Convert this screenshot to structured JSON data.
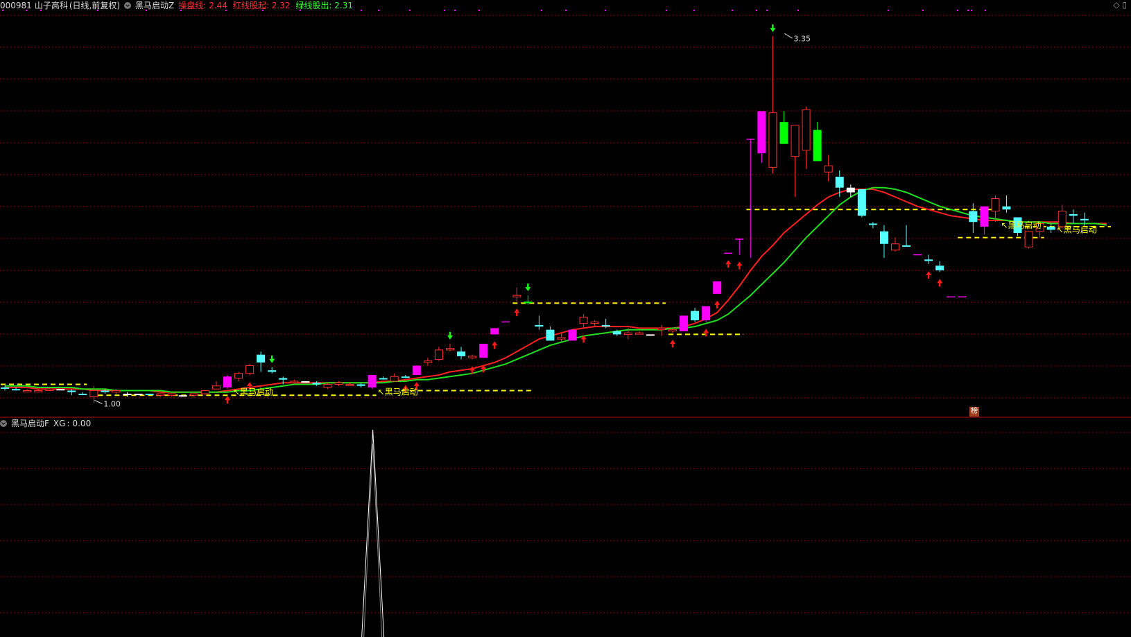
{
  "main_header": {
    "code": "000981",
    "name": "山子高科",
    "period": "(日线,前复权)",
    "indicator_name": "黑马启动Z",
    "items": [
      {
        "label": "操盘线",
        "value": "2.44",
        "color": "#ff3030"
      },
      {
        "label": "红线股起",
        "value": "2.32",
        "color": "#ff3030"
      },
      {
        "label": "绿线股出",
        "value": "2.31",
        "color": "#30ff30"
      }
    ]
  },
  "sub_header": {
    "indicator_name": "黑马启动F",
    "items": [
      {
        "label": "XG",
        "value": "0.00"
      }
    ]
  },
  "corner_icon": "diamond-icon",
  "badge_text": "榜",
  "colors": {
    "grid": "#8b0000",
    "up": "#ff3030",
    "down_cyan": "#54ffff",
    "magenta": "#ff00ff",
    "green_bar": "#00ff00",
    "red_line": "#ff2020",
    "green_line": "#20e020",
    "yellow_dash": "#ffff00",
    "label_text": "#ffff00"
  },
  "chart_data": [
    {
      "type": "candlestick",
      "ylim": [
        0.95,
        3.5
      ],
      "y_is_log": false,
      "annotations": [
        {
          "text": "3.35",
          "kind": "high",
          "bar": 70,
          "price": 3.35
        },
        {
          "text": "1.00",
          "kind": "low",
          "bar": 8,
          "price": 1.0
        },
        {
          "text": "黑马启动",
          "kind": "signal",
          "bar": 20,
          "price": 1.07
        },
        {
          "text": "黑马启动",
          "kind": "signal",
          "bar": 33,
          "price": 1.07
        },
        {
          "text": "黑马启动",
          "kind": "signal",
          "bar": 89,
          "price": 2.14
        },
        {
          "text": "黑马启动",
          "kind": "signal",
          "bar": 94,
          "price": 2.11
        }
      ],
      "candles": [
        [
          1.1,
          1.11,
          1.08,
          1.1,
          "c"
        ],
        [
          1.09,
          1.1,
          1.08,
          1.09,
          "c"
        ],
        [
          1.08,
          1.09,
          1.08,
          1.08,
          "r"
        ],
        [
          1.08,
          1.09,
          1.07,
          1.08,
          "r"
        ],
        [
          1.08,
          1.1,
          1.08,
          1.09,
          "r"
        ],
        [
          1.09,
          1.09,
          1.09,
          1.09,
          "w"
        ],
        [
          1.08,
          1.09,
          1.05,
          1.07,
          "c"
        ],
        [
          1.06,
          1.07,
          1.05,
          1.06,
          "c"
        ],
        [
          1.04,
          1.11,
          1.0,
          1.08,
          "r"
        ],
        [
          1.08,
          1.09,
          1.06,
          1.07,
          "c"
        ],
        [
          1.07,
          1.09,
          1.06,
          1.08,
          "r"
        ],
        [
          1.06,
          1.07,
          1.04,
          1.06,
          "w"
        ],
        [
          1.06,
          1.06,
          1.05,
          1.06,
          "w"
        ],
        [
          1.06,
          1.06,
          1.05,
          1.06,
          "c"
        ],
        [
          1.05,
          1.06,
          1.04,
          1.06,
          "r"
        ],
        [
          1.05,
          1.06,
          1.04,
          1.06,
          "r"
        ],
        [
          1.05,
          1.05,
          1.04,
          1.05,
          "w"
        ],
        [
          1.05,
          1.06,
          1.04,
          1.06,
          "r"
        ],
        [
          1.06,
          1.08,
          1.05,
          1.08,
          "r"
        ],
        [
          1.09,
          1.14,
          1.09,
          1.11,
          "r"
        ],
        [
          1.1,
          1.18,
          1.09,
          1.17,
          "m"
        ],
        [
          1.16,
          1.2,
          1.14,
          1.19,
          "r"
        ],
        [
          1.19,
          1.25,
          1.18,
          1.24,
          "r"
        ],
        [
          1.31,
          1.33,
          1.2,
          1.26,
          "c"
        ],
        [
          1.2,
          1.23,
          1.19,
          1.21,
          "c"
        ],
        [
          1.15,
          1.17,
          1.12,
          1.16,
          "c"
        ],
        [
          1.14,
          1.15,
          1.13,
          1.14,
          "r"
        ],
        [
          1.14,
          1.14,
          1.13,
          1.14,
          "w"
        ],
        [
          1.13,
          1.14,
          1.11,
          1.12,
          "c"
        ],
        [
          1.1,
          1.13,
          1.09,
          1.12,
          "r"
        ],
        [
          1.12,
          1.14,
          1.11,
          1.13,
          "r"
        ],
        [
          1.12,
          1.13,
          1.11,
          1.12,
          "r"
        ],
        [
          1.12,
          1.13,
          1.1,
          1.11,
          "c"
        ],
        [
          1.1,
          1.18,
          1.09,
          1.18,
          "m"
        ],
        [
          1.16,
          1.17,
          1.15,
          1.16,
          "c"
        ],
        [
          1.14,
          1.19,
          1.14,
          1.17,
          "r"
        ],
        [
          1.17,
          1.18,
          1.16,
          1.17,
          "c"
        ],
        [
          1.18,
          1.24,
          1.18,
          1.24,
          "m"
        ],
        [
          1.26,
          1.29,
          1.24,
          1.27,
          "r"
        ],
        [
          1.28,
          1.36,
          1.27,
          1.34,
          "r"
        ],
        [
          1.34,
          1.38,
          1.33,
          1.35,
          "r"
        ],
        [
          1.33,
          1.36,
          1.28,
          1.3,
          "c"
        ],
        [
          1.29,
          1.31,
          1.28,
          1.3,
          "r"
        ],
        [
          1.29,
          1.38,
          1.29,
          1.38,
          "m"
        ],
        [
          1.44,
          1.48,
          1.44,
          1.48,
          "m"
        ],
        [
          1.52,
          1.52,
          1.52,
          1.52,
          "p"
        ],
        [
          1.69,
          1.74,
          1.65,
          1.68,
          "r"
        ],
        [
          1.65,
          1.69,
          1.63,
          1.64,
          "g"
        ],
        [
          1.5,
          1.56,
          1.47,
          1.49,
          "c"
        ],
        [
          1.47,
          1.49,
          1.4,
          1.4,
          "c"
        ],
        [
          1.41,
          1.45,
          1.39,
          1.42,
          "r"
        ],
        [
          1.4,
          1.47,
          1.4,
          1.47,
          "m"
        ],
        [
          1.51,
          1.57,
          1.48,
          1.55,
          "r"
        ],
        [
          1.51,
          1.53,
          1.49,
          1.52,
          "r"
        ],
        [
          1.5,
          1.54,
          1.48,
          1.49,
          "c"
        ],
        [
          1.46,
          1.47,
          1.43,
          1.44,
          "c"
        ],
        [
          1.44,
          1.48,
          1.41,
          1.45,
          "r"
        ],
        [
          1.45,
          1.46,
          1.44,
          1.45,
          "r"
        ],
        [
          1.44,
          1.44,
          1.43,
          1.44,
          "w"
        ],
        [
          1.47,
          1.5,
          1.43,
          1.48,
          "r"
        ],
        [
          1.47,
          1.48,
          1.45,
          1.47,
          "r"
        ],
        [
          1.46,
          1.56,
          1.46,
          1.56,
          "m"
        ],
        [
          1.53,
          1.61,
          1.52,
          1.59,
          "c"
        ],
        [
          1.53,
          1.62,
          1.52,
          1.62,
          "m"
        ],
        [
          1.7,
          1.78,
          1.7,
          1.78,
          "m"
        ],
        [
          1.96,
          1.96,
          1.96,
          1.96,
          "p"
        ],
        [
          2.05,
          2.05,
          1.95,
          2.05,
          "p"
        ],
        [
          2.69,
          2.69,
          1.93,
          2.69,
          "p"
        ],
        [
          2.6,
          2.7,
          2.54,
          2.87,
          "m"
        ],
        [
          2.51,
          3.35,
          2.47,
          2.86,
          "r"
        ],
        [
          2.8,
          2.87,
          2.69,
          2.66,
          "g"
        ],
        [
          2.58,
          2.74,
          2.32,
          2.78,
          "r"
        ],
        [
          2.62,
          2.9,
          2.5,
          2.88,
          "r"
        ],
        [
          2.75,
          2.8,
          2.59,
          2.55,
          "g"
        ],
        [
          2.52,
          2.59,
          2.42,
          2.48,
          "r"
        ],
        [
          2.45,
          2.49,
          2.32,
          2.38,
          "c"
        ],
        [
          2.38,
          2.4,
          2.32,
          2.35,
          "w"
        ],
        [
          2.37,
          2.37,
          2.19,
          2.2,
          "c"
        ],
        [
          2.15,
          2.16,
          2.12,
          2.15,
          "c"
        ],
        [
          2.1,
          2.14,
          1.93,
          2.02,
          "c"
        ],
        [
          1.98,
          2.06,
          1.97,
          2.02,
          "r"
        ],
        [
          2.01,
          2.14,
          2.01,
          2.01,
          "c"
        ],
        [
          1.95,
          1.95,
          1.95,
          1.95,
          "p"
        ],
        [
          1.91,
          1.95,
          1.89,
          1.92,
          "c"
        ],
        [
          1.88,
          1.91,
          1.84,
          1.85,
          "c"
        ],
        [
          1.68,
          1.68,
          1.68,
          1.68,
          "p"
        ],
        [
          1.68,
          1.68,
          1.68,
          1.68,
          "p"
        ],
        [
          2.23,
          2.28,
          2.09,
          2.16,
          "c"
        ],
        [
          2.26,
          2.26,
          2.08,
          2.13,
          "m"
        ],
        [
          2.23,
          2.33,
          2.16,
          2.31,
          "r"
        ],
        [
          2.26,
          2.33,
          2.22,
          2.24,
          "c"
        ],
        [
          2.19,
          2.19,
          2.07,
          2.09,
          "c"
        ],
        [
          2.0,
          2.1,
          1.99,
          2.1,
          "r"
        ],
        [
          2.1,
          2.13,
          2.06,
          2.15,
          "r"
        ],
        [
          2.11,
          2.15,
          2.09,
          2.13,
          "c"
        ],
        [
          2.13,
          2.27,
          2.12,
          2.23,
          "r"
        ],
        [
          2.21,
          2.24,
          2.15,
          2.2,
          "c"
        ],
        [
          2.18,
          2.22,
          2.14,
          2.17,
          "c"
        ]
      ],
      "series": [
        {
          "name": "操盘线",
          "color": "#ff2020",
          "values": [
            1.1,
            1.1,
            1.1,
            1.09,
            1.09,
            1.09,
            1.09,
            1.09,
            1.08,
            1.08,
            1.08,
            1.08,
            1.08,
            1.08,
            1.07,
            1.07,
            1.07,
            1.07,
            1.07,
            1.07,
            1.08,
            1.09,
            1.1,
            1.11,
            1.12,
            1.13,
            1.13,
            1.13,
            1.13,
            1.13,
            1.13,
            1.13,
            1.13,
            1.13,
            1.14,
            1.14,
            1.15,
            1.16,
            1.17,
            1.18,
            1.2,
            1.21,
            1.22,
            1.24,
            1.26,
            1.29,
            1.33,
            1.37,
            1.41,
            1.43,
            1.45,
            1.47,
            1.48,
            1.49,
            1.49,
            1.49,
            1.49,
            1.48,
            1.48,
            1.48,
            1.48,
            1.49,
            1.51,
            1.54,
            1.58,
            1.66,
            1.75,
            1.85,
            1.94,
            2.01,
            2.09,
            2.15,
            2.21,
            2.27,
            2.32,
            2.35,
            2.37,
            2.37,
            2.37,
            2.35,
            2.32,
            2.29,
            2.26,
            2.24,
            2.22,
            2.2,
            2.19,
            2.18,
            2.17,
            2.17,
            2.17,
            2.16,
            2.16,
            2.16,
            2.16,
            2.16,
            2.15,
            2.15,
            2.15,
            2.15
          ]
        },
        {
          "name": "绿线",
          "color": "#20e020",
          "values": [
            1.11,
            1.11,
            1.11,
            1.1,
            1.1,
            1.1,
            1.1,
            1.09,
            1.09,
            1.09,
            1.08,
            1.08,
            1.08,
            1.08,
            1.08,
            1.07,
            1.07,
            1.07,
            1.07,
            1.07,
            1.07,
            1.08,
            1.08,
            1.09,
            1.1,
            1.11,
            1.12,
            1.12,
            1.12,
            1.13,
            1.13,
            1.13,
            1.13,
            1.13,
            1.13,
            1.14,
            1.14,
            1.15,
            1.15,
            1.16,
            1.17,
            1.18,
            1.19,
            1.21,
            1.23,
            1.25,
            1.28,
            1.31,
            1.34,
            1.37,
            1.39,
            1.41,
            1.43,
            1.44,
            1.45,
            1.46,
            1.47,
            1.47,
            1.47,
            1.47,
            1.48,
            1.48,
            1.49,
            1.51,
            1.53,
            1.57,
            1.63,
            1.69,
            1.76,
            1.83,
            1.9,
            1.98,
            2.06,
            2.13,
            2.2,
            2.27,
            2.32,
            2.36,
            2.38,
            2.38,
            2.37,
            2.35,
            2.32,
            2.29,
            2.26,
            2.24,
            2.22,
            2.2,
            2.19,
            2.18,
            2.17,
            2.16,
            2.16,
            2.16,
            2.15,
            2.15,
            2.15,
            2.15,
            2.15,
            2.14
          ]
        }
      ],
      "up_arrows": [
        20,
        22,
        36,
        37,
        42,
        43,
        44,
        46,
        52,
        60,
        63,
        64,
        65,
        66,
        83,
        84
      ],
      "down_arrows": [
        24,
        40,
        47,
        69
      ],
      "support_lines": [
        {
          "price": 1.12,
          "from_bar": 0,
          "to_bar": 7
        },
        {
          "price": 1.05,
          "from_bar": 8,
          "to_bar": 33
        },
        {
          "price": 1.08,
          "from_bar": 36,
          "to_bar": 47
        },
        {
          "price": 1.64,
          "from_bar": 46,
          "to_bar": 59
        },
        {
          "price": 1.44,
          "from_bar": 60,
          "to_bar": 66
        },
        {
          "price": 2.24,
          "from_bar": 67,
          "to_bar": 89
        },
        {
          "price": 2.06,
          "from_bar": 86,
          "to_bar": 93
        },
        {
          "price": 2.13,
          "from_bar": 92,
          "to_bar": 99
        }
      ]
    },
    {
      "type": "line",
      "name": "XG",
      "ylim": [
        0,
        1
      ],
      "spike_bar": 33,
      "spike_value": 1
    }
  ]
}
